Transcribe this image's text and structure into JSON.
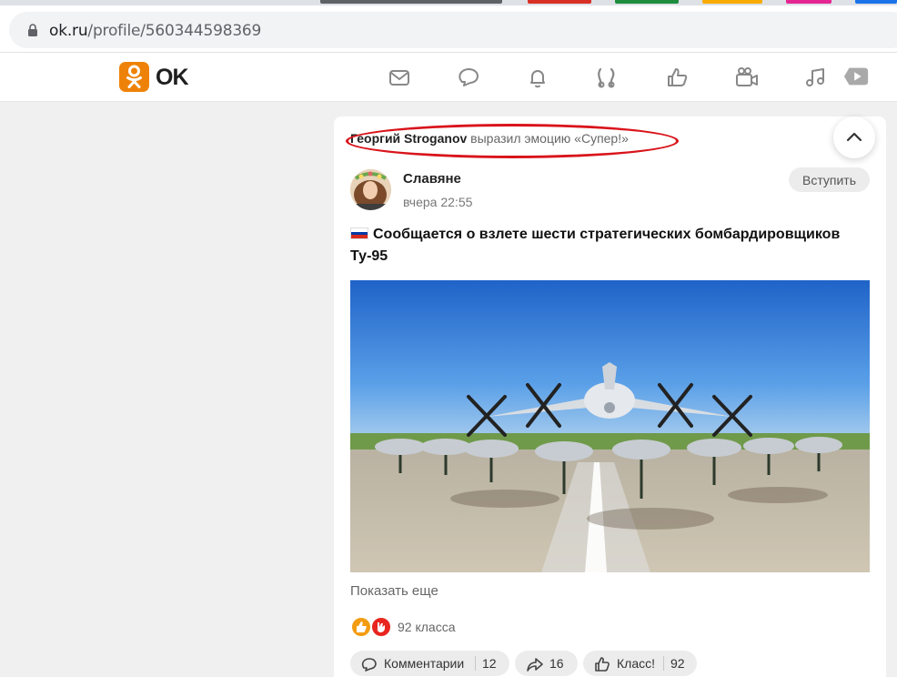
{
  "browser": {
    "url_host": "ok.ru",
    "url_path": "/profile/560344598369"
  },
  "header": {
    "logo_text": "OK",
    "nav_icons": [
      "mail-icon",
      "chat-icon",
      "bell-icon",
      "guests-icon",
      "likes-icon",
      "video-icon",
      "music-icon",
      "video-play-icon"
    ]
  },
  "feed": {
    "activity": {
      "user": "Георгий Stroganov",
      "action": " выразил эмоцию «Супер!»"
    },
    "post": {
      "group_name": "Славяне",
      "date": "вчера 22:55",
      "join_label": "Вступить",
      "title": "Сообщается о взлете шести стратегических бомбардировщиков Ту-95",
      "show_more": "Показать еще",
      "reactions_count": "92 класса",
      "comments_label": "Комментарии",
      "comments_count": "12",
      "shares_count": "16",
      "like_label": "Класс!",
      "like_count": "92"
    }
  },
  "colors": {
    "brand": "#ee8208",
    "highlight": "#d9141b"
  }
}
